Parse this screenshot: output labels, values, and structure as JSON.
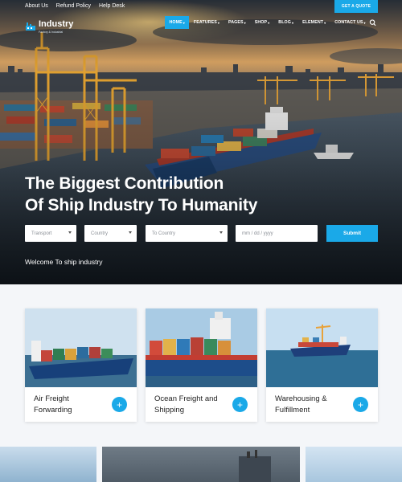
{
  "topbar": {
    "links": [
      "About Us",
      "Refund Policy",
      "Help Desk"
    ],
    "quote_button": "GET A QUOTE"
  },
  "logo": {
    "name": "Industry",
    "tagline": "Factory & Industrial"
  },
  "nav": {
    "items": [
      {
        "label": "HOME",
        "active": true
      },
      {
        "label": "FEATURES",
        "active": false
      },
      {
        "label": "PAGES",
        "active": false
      },
      {
        "label": "SHOP",
        "active": false
      },
      {
        "label": "BLOG",
        "active": false
      },
      {
        "label": "ELEMENT",
        "active": false
      },
      {
        "label": "CONTACT US",
        "active": false
      }
    ],
    "search_icon": "search-icon"
  },
  "hero": {
    "headline_line1": "The Biggest Contribution",
    "headline_line2": "Of Ship Industry To Humanity",
    "form": {
      "transport_placeholder": "Transport",
      "country_placeholder": "Country",
      "to_country_placeholder": "To Country",
      "date_placeholder": "mm / dd / yyyy",
      "submit_label": "Submit"
    },
    "welcome": "Welcome To ship industry"
  },
  "services": [
    {
      "title_line1": "Air Freight",
      "title_line2": "Forwarding"
    },
    {
      "title_line1": "Ocean Freight and",
      "title_line2": "Shipping"
    },
    {
      "title_line1": "Warehousing &",
      "title_line2": "Fulfillment"
    }
  ],
  "colors": {
    "accent": "#1aa9e8",
    "text_dark": "#222222",
    "background": "#f4f6f9"
  }
}
